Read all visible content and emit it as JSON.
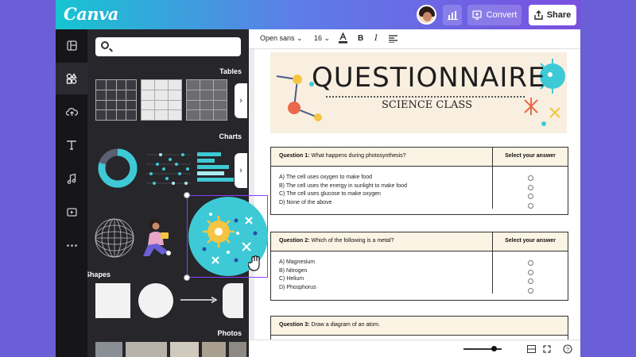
{
  "app": {
    "name": "Canva"
  },
  "topbar": {
    "convert_label": "Convert",
    "share_label": "Share"
  },
  "rail": {
    "items": [
      "layout-icon",
      "elements-icon",
      "upload-icon",
      "text-icon",
      "music-icon",
      "video-icon",
      "more-icon"
    ],
    "active_index": 1
  },
  "panel": {
    "search_placeholder": "",
    "sections": {
      "tables": "Tables",
      "charts": "Charts",
      "lines": "Lines & Shapes",
      "photos": "Photos"
    }
  },
  "editor": {
    "font": "Open sans",
    "font_size": "16",
    "bold": "B",
    "italic": "I"
  },
  "document": {
    "title": "QUESTIONNAIRE",
    "subtitle": "SCIENCE CLASS",
    "answer_header": "Select your answer",
    "questions": [
      {
        "label": "Question 1:",
        "text": "What happens during photosynthesis?",
        "options": [
          "A) The cell uses oxygen to make food",
          "B) The cell uses the energy in sunlight to make food",
          "C) The cell uses glucose to make oxygen",
          "D) None of the above"
        ]
      },
      {
        "label": "Question 2:",
        "text": "Which of the following is a metal?",
        "options": [
          "A) Magnesium",
          "B) Nitrogen",
          "C) Helium",
          "D) Phosphorus"
        ]
      },
      {
        "label": "Question 3:",
        "text": "Draw a diagram of an atom."
      }
    ]
  },
  "colors": {
    "accent": "#8b3dff",
    "header_band": "#f8efe0",
    "teal": "#3ec9d6"
  }
}
